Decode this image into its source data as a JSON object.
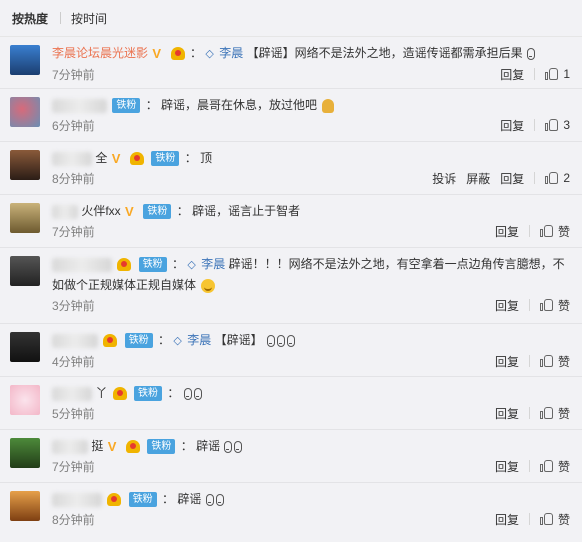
{
  "sort": {
    "by_heat": "按热度",
    "by_time": "按时间"
  },
  "labels": {
    "reply": "回复",
    "report": "投诉",
    "block": "屏蔽",
    "fan": "铁粉"
  },
  "comments": [
    {
      "user": "李晨论坛晨光迷影",
      "mention": "李晨",
      "text": "【辟谣】网络不是法外之地，造谣传谣都需承担后果",
      "time": "7分钟前",
      "likes": "1"
    },
    {
      "user": "",
      "text": "辟谣，晨哥在休息，放过他吧",
      "time": "6分钟前",
      "likes": "3"
    },
    {
      "user": "全",
      "text": "顶",
      "time": "8分钟前",
      "likes": "2"
    },
    {
      "user": "火伴fxx",
      "text": "辟谣，谣言止于智者",
      "time": "7分钟前",
      "likes": "赞"
    },
    {
      "user": "",
      "mention": "李晨",
      "text": "辟谣！！！网络不是法外之地，有空拿着一点边角传言臆想，不如做个正规媒体正规自媒体",
      "time": "3分钟前",
      "likes": "赞"
    },
    {
      "user": "",
      "mention": "李晨",
      "text": "【辟谣】",
      "time": "4分钟前",
      "likes": "赞"
    },
    {
      "user": "丫",
      "text": "",
      "time": "5分钟前",
      "likes": "赞"
    },
    {
      "user": "挺",
      "text": "辟谣",
      "time": "7分钟前",
      "likes": "赞"
    },
    {
      "user": "",
      "text": "辟谣",
      "time": "8分钟前",
      "likes": "赞"
    }
  ]
}
